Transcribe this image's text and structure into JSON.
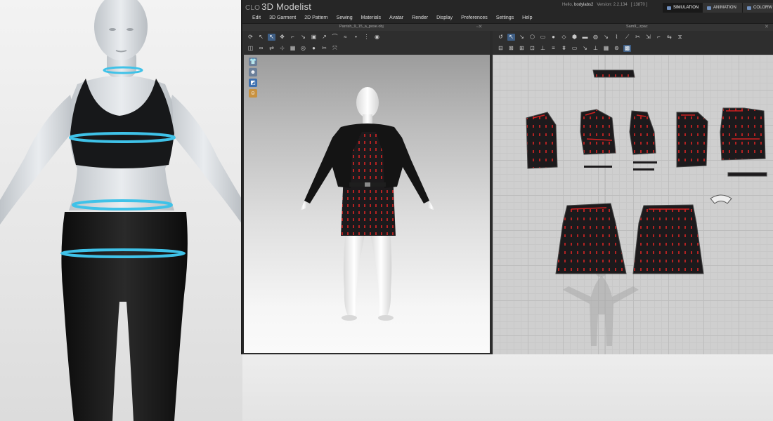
{
  "app": {
    "logo_prefix": "CLO",
    "title": "3D Modelist",
    "greeting": "Hello,",
    "username": "bodylabs2",
    "version_label": "Version:",
    "version": "2.2.134",
    "build": "[ 13870 ]"
  },
  "mode_tabs": [
    "SIMULATION",
    "ANIMATION",
    "COLORW"
  ],
  "menu": [
    "Edit",
    "3D Garment",
    "2D Pattern",
    "Sewing",
    "Materials",
    "Avatar",
    "Render",
    "Display",
    "Preferences",
    "Settings",
    "Help"
  ],
  "panes": {
    "left_title": "Parrish_9_15_a_pose.obj",
    "right_title": "Sam9_.zpac"
  },
  "icons": {
    "toolbar_left_row1": [
      "rotate-icon",
      "select-icon",
      "select-mesh-icon",
      "move-icon",
      "fold-icon",
      "pin-icon",
      "box-pin-icon",
      "tack-icon",
      "measure-icon",
      "steam-icon",
      "point-icon",
      "zipper-icon",
      "button-icon"
    ],
    "toolbar_left_row2": [
      "pattern-icon",
      "sewing-icon",
      "internal-line-icon",
      "arrange-icon",
      "texture-icon",
      "circle-icon",
      "fit-icon",
      "wrinkle-icon",
      "strengthen-icon"
    ],
    "toolbar_right_row1": [
      "undo-icon",
      "select-point-icon",
      "edit-pattern-icon",
      "polygon-icon",
      "rectangle-icon",
      "circle-shape-icon",
      "dart-icon",
      "internal-polygon-icon",
      "internal-rect-icon",
      "internal-circle-icon",
      "add-point-icon",
      "curve-icon",
      "slash-icon",
      "cut-icon",
      "offset-icon",
      "fold-line-icon",
      "mirror-icon",
      "symmetry-icon"
    ],
    "toolbar_right_row2": [
      "segment-sew-icon",
      "free-sew-icon",
      "check-sew-icon",
      "trace-icon",
      "notch-icon",
      "pleat-icon",
      "fold-arrange-icon",
      "ruler-icon",
      "annotation-icon",
      "grading-icon",
      "texture-2d-icon",
      "grid-toggle-icon",
      "tile-icon"
    ],
    "view3d_tools": [
      "garment-display-icon",
      "avatar-display-icon",
      "texture-display-icon",
      "avatar-silhouette-icon"
    ]
  },
  "colors": {
    "panel_bg": "#2b2b2b",
    "menubar_bg": "#262626",
    "accent_blue": "#3f5f86",
    "measure_ring": "#3fc2e8",
    "garment_fabric": "#1c1a1c",
    "sewing_line": "#d02020"
  }
}
